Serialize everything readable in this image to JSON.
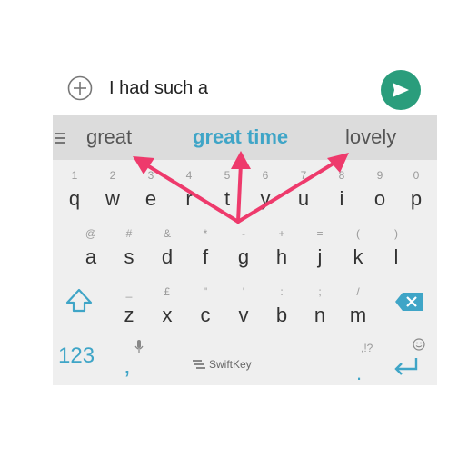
{
  "compose": {
    "text": "I had such a",
    "add_icon": "plus-circle-icon",
    "send_icon": "send-icon",
    "send_color": "#2a9d7c"
  },
  "suggestions": {
    "left": "great",
    "middle": "great time",
    "right": "lovely",
    "menu_icon": "menu-icon",
    "accent": "#3fa5c7"
  },
  "rows": [
    [
      {
        "main": "q",
        "hint": "1"
      },
      {
        "main": "w",
        "hint": "2"
      },
      {
        "main": "e",
        "hint": "3"
      },
      {
        "main": "r",
        "hint": "4"
      },
      {
        "main": "t",
        "hint": "5"
      },
      {
        "main": "y",
        "hint": "6"
      },
      {
        "main": "u",
        "hint": "7"
      },
      {
        "main": "i",
        "hint": "8"
      },
      {
        "main": "o",
        "hint": "9"
      },
      {
        "main": "p",
        "hint": "0"
      }
    ],
    [
      {
        "main": "a",
        "hint": "@"
      },
      {
        "main": "s",
        "hint": "#"
      },
      {
        "main": "d",
        "hint": "&"
      },
      {
        "main": "f",
        "hint": "*"
      },
      {
        "main": "g",
        "hint": "-"
      },
      {
        "main": "h",
        "hint": "+"
      },
      {
        "main": "j",
        "hint": "="
      },
      {
        "main": "k",
        "hint": "("
      },
      {
        "main": "l",
        "hint": ")"
      }
    ],
    [
      {
        "main": "z",
        "hint": "_"
      },
      {
        "main": "x",
        "hint": "£"
      },
      {
        "main": "c",
        "hint": "\""
      },
      {
        "main": "v",
        "hint": "'"
      },
      {
        "main": "b",
        "hint": ":"
      },
      {
        "main": "n",
        "hint": ";"
      },
      {
        "main": "m",
        "hint": "/"
      }
    ]
  ],
  "bottom": {
    "num_label": "123",
    "comma": ",",
    "brand": "SwiftKey",
    "period_hint": ",!?",
    "period": ".",
    "shift_icon": "shift-icon",
    "backspace_icon": "backspace-icon",
    "mic_icon": "mic-icon",
    "emoji_icon": "smiley-icon",
    "enter_icon": "enter-icon"
  },
  "annotation": {
    "arrow_color": "#ee3a6c"
  }
}
